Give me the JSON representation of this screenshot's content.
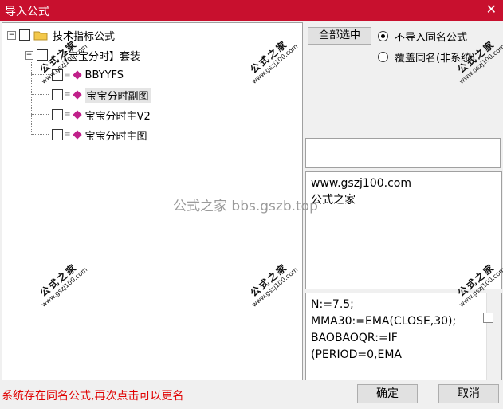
{
  "window": {
    "title": "导入公式",
    "close_glyph": "✕"
  },
  "tree": {
    "root_label": "技术指标公式",
    "group_label": "【宝宝分时】套装",
    "items": [
      "BBYYFS",
      "宝宝分时副图",
      "宝宝分时主V2",
      "宝宝分时主图"
    ],
    "selected_index": 1
  },
  "right": {
    "select_all_label": "全部选中",
    "options": [
      {
        "label": "不导入同名公式",
        "checked": true
      },
      {
        "label": "覆盖同名(非系统)",
        "checked": false
      }
    ],
    "info_text": "www.gszj100.com\n公式之家",
    "code_text": "N:=7.5;\nMMA30:=EMA(CLOSE,30);\nBAOBAOQR:=IF\n(PERIOD=0,EMA"
  },
  "watermarks": {
    "brand": "公式之家",
    "url": "www.gszj100.com",
    "center": "公式之家 bbs.gszb.top"
  },
  "status_text": "系统存在同名公式,再次点击可以更名",
  "buttons": {
    "confirm": "确定",
    "cancel": "取消"
  },
  "colors": {
    "titlebar": "#c8102e",
    "status": "#e00000",
    "folder": "#f3c84a",
    "gem": "#c0208a"
  }
}
